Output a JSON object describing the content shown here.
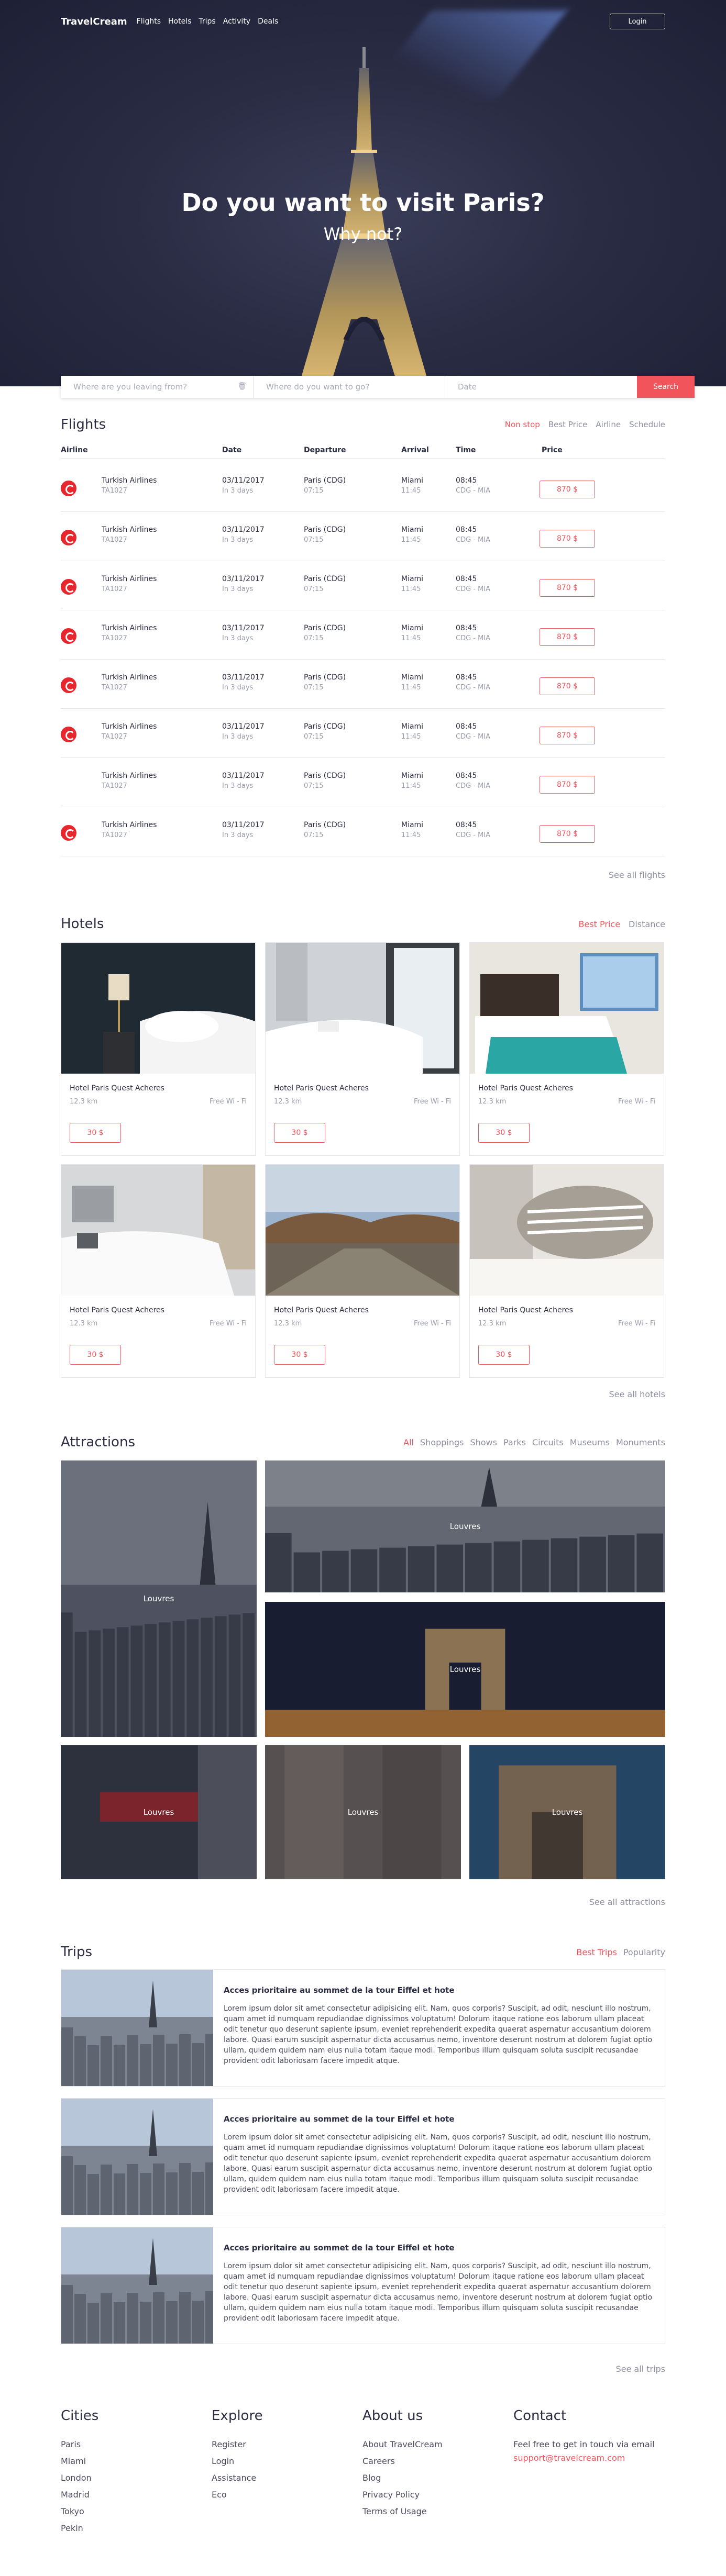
{
  "nav": {
    "logo": "TravelCream",
    "links": [
      "Flights",
      "Hotels",
      "Trips",
      "Activity",
      "Deals"
    ],
    "login": "Login"
  },
  "hero": {
    "title": "Do you want to visit Paris?",
    "subtitle": "Why not?"
  },
  "search": {
    "from_placeholder": "Where are you leaving from?",
    "to_placeholder": "Where do you want to go?",
    "date_placeholder": "Date",
    "button": "Search"
  },
  "flights": {
    "title": "Flights",
    "filters": [
      "Non stop",
      "Best Price",
      "Airline",
      "Schedule"
    ],
    "columns": [
      "Airline",
      "Date",
      "Departure",
      "Arrival",
      "Time",
      "Price"
    ],
    "rows": [
      {
        "airline": "Turkish Airlines",
        "code": "TA1027",
        "date": "03/11/2017",
        "date_sub": "In 3 days",
        "departure": "Paris (CDG)",
        "dep_time": "07:15",
        "arrival": "Miami",
        "arr_time": "11:45",
        "time": "08:45",
        "route": "CDG - MIA",
        "price": "870 $",
        "logo": true
      },
      {
        "airline": "Turkish Airlines",
        "code": "TA1027",
        "date": "03/11/2017",
        "date_sub": "In 3 days",
        "departure": "Paris (CDG)",
        "dep_time": "07:15",
        "arrival": "Miami",
        "arr_time": "11:45",
        "time": "08:45",
        "route": "CDG - MIA",
        "price": "870 $",
        "logo": true
      },
      {
        "airline": "Turkish Airlines",
        "code": "TA1027",
        "date": "03/11/2017",
        "date_sub": "In 3 days",
        "departure": "Paris (CDG)",
        "dep_time": "07:15",
        "arrival": "Miami",
        "arr_time": "11:45",
        "time": "08:45",
        "route": "CDG - MIA",
        "price": "870 $",
        "logo": true
      },
      {
        "airline": "Turkish Airlines",
        "code": "TA1027",
        "date": "03/11/2017",
        "date_sub": "In 3 days",
        "departure": "Paris (CDG)",
        "dep_time": "07:15",
        "arrival": "Miami",
        "arr_time": "11:45",
        "time": "08:45",
        "route": "CDG - MIA",
        "price": "870 $",
        "logo": true
      },
      {
        "airline": "Turkish Airlines",
        "code": "TA1027",
        "date": "03/11/2017",
        "date_sub": "In 3 days",
        "departure": "Paris (CDG)",
        "dep_time": "07:15",
        "arrival": "Miami",
        "arr_time": "11:45",
        "time": "08:45",
        "route": "CDG - MIA",
        "price": "870 $",
        "logo": true
      },
      {
        "airline": "Turkish Airlines",
        "code": "TA1027",
        "date": "03/11/2017",
        "date_sub": "In 3 days",
        "departure": "Paris (CDG)",
        "dep_time": "07:15",
        "arrival": "Miami",
        "arr_time": "11:45",
        "time": "08:45",
        "route": "CDG - MIA",
        "price": "870 $",
        "logo": true
      },
      {
        "airline": "Turkish Airlines",
        "code": "TA1027",
        "date": "03/11/2017",
        "date_sub": "In 3 days",
        "departure": "Paris (CDG)",
        "dep_time": "07:15",
        "arrival": "Miami",
        "arr_time": "11:45",
        "time": "08:45",
        "route": "CDG - MIA",
        "price": "870 $",
        "logo": false
      },
      {
        "airline": "Turkish Airlines",
        "code": "TA1027",
        "date": "03/11/2017",
        "date_sub": "In 3 days",
        "departure": "Paris (CDG)",
        "dep_time": "07:15",
        "arrival": "Miami",
        "arr_time": "11:45",
        "time": "08:45",
        "route": "CDG - MIA",
        "price": "870 $",
        "logo": true
      }
    ],
    "see_all": "See all flights"
  },
  "hotels": {
    "title": "Hotels",
    "filters": [
      "Best Price",
      "Distance"
    ],
    "cards": [
      {
        "name": "Hotel Paris Quest Acheres",
        "distance": "12.3 km",
        "wifi": "Free Wi - Fi",
        "price": "30 $",
        "scene": "dark-lamp"
      },
      {
        "name": "Hotel Paris Quest Acheres",
        "distance": "12.3 km",
        "wifi": "Free Wi - Fi",
        "price": "30 $",
        "scene": "white-window"
      },
      {
        "name": "Hotel Paris Quest Acheres",
        "distance": "12.3 km",
        "wifi": "Free Wi - Fi",
        "price": "30 $",
        "scene": "teal-bed"
      },
      {
        "name": "Hotel Paris Quest Acheres",
        "distance": "12.3 km",
        "wifi": "Free Wi - Fi",
        "price": "30 $",
        "scene": "white-bed"
      },
      {
        "name": "Hotel Paris Quest Acheres",
        "distance": "12.3 km",
        "wifi": "Free Wi - Fi",
        "price": "30 $",
        "scene": "terrace"
      },
      {
        "name": "Hotel Paris Quest Acheres",
        "distance": "12.3 km",
        "wifi": "Free Wi - Fi",
        "price": "30 $",
        "scene": "pillows"
      }
    ],
    "see_all": "See all hotels"
  },
  "attractions": {
    "title": "Attractions",
    "filters": [
      "All",
      "Shoppings",
      "Shows",
      "Parks",
      "Circuits",
      "Museums",
      "Monuments"
    ],
    "tiles": [
      {
        "label": "Louvres",
        "scene": "tower-city"
      },
      {
        "label": "Louvres",
        "scene": "skyline"
      },
      {
        "label": "Louvres",
        "scene": "arc-night"
      },
      {
        "label": "Louvres",
        "scene": "metro"
      },
      {
        "label": "Louvres",
        "scene": "street"
      },
      {
        "label": "Louvres",
        "scene": "arc-day"
      }
    ],
    "see_all": "See all attractions"
  },
  "trips": {
    "title": "Trips",
    "filters": [
      "Best Trips",
      "Popularity"
    ],
    "items": [
      {
        "title": "Acces prioritaire au sommet de la tour Eiffel et hote",
        "text": "Lorem ipsum dolor sit amet consectetur adipisicing elit. Nam, quos corporis? Suscipit, ad odit, nesciunt illo nostrum, quam amet id numquam repudiandae dignissimos voluptatum! Dolorum itaque ratione eos laborum ullam placeat odit tenetur quo deserunt sapiente ipsum, eveniet reprehenderit expedita quaerat aspernatur accusantium dolorem labore. Quasi earum suscipit aspernatur dicta accusamus nemo, inventore deserunt nostrum at dolorem fugiat optio ullam, quidem quidem nam eius nulla totam itaque modi. Temporibus illum quisquam soluta suscipit recusandae provident odit laboriosam facere impedit atque."
      },
      {
        "title": "Acces prioritaire au sommet de la tour Eiffel et hote",
        "text": "Lorem ipsum dolor sit amet consectetur adipisicing elit. Nam, quos corporis? Suscipit, ad odit, nesciunt illo nostrum, quam amet id numquam repudiandae dignissimos voluptatum! Dolorum itaque ratione eos laborum ullam placeat odit tenetur quo deserunt sapiente ipsum, eveniet reprehenderit expedita quaerat aspernatur accusantium dolorem labore. Quasi earum suscipit aspernatur dicta accusamus nemo, inventore deserunt nostrum at dolorem fugiat optio ullam, quidem quidem nam eius nulla totam itaque modi. Temporibus illum quisquam soluta suscipit recusandae provident odit laboriosam facere impedit atque."
      },
      {
        "title": "Acces prioritaire au sommet de la tour Eiffel et hote",
        "text": "Lorem ipsum dolor sit amet consectetur adipisicing elit. Nam, quos corporis? Suscipit, ad odit, nesciunt illo nostrum, quam amet id numquam repudiandae dignissimos voluptatum! Dolorum itaque ratione eos laborum ullam placeat odit tenetur quo deserunt sapiente ipsum, eveniet reprehenderit expedita quaerat aspernatur accusantium dolorem labore. Quasi earum suscipit aspernatur dicta accusamus nemo, inventore deserunt nostrum at dolorem fugiat optio ullam, quidem quidem nam eius nulla totam itaque modi. Temporibus illum quisquam soluta suscipit recusandae provident odit laboriosam facere impedit atque."
      }
    ],
    "see_all": "See all trips"
  },
  "footer": {
    "cities": {
      "title": "Cities",
      "items": [
        "Paris",
        "Miami",
        "London",
        "Madrid",
        "Tokyo",
        "Pekin"
      ]
    },
    "explore": {
      "title": "Explore",
      "items": [
        "Register",
        "Login",
        "Assistance",
        "Eco"
      ]
    },
    "about": {
      "title": "About us",
      "items": [
        "About TravelCream",
        "Careers",
        "Blog",
        "Privacy Policy",
        "Terms of Usage"
      ]
    },
    "contact": {
      "title": "Contact",
      "text": "Feel free to get in touch via email",
      "email": "support@travelcream.com"
    }
  },
  "colors": {
    "accent": "#f2545b",
    "text": "#2b2d42",
    "muted": "#8d8fa0",
    "hero": "#2a2c44"
  }
}
